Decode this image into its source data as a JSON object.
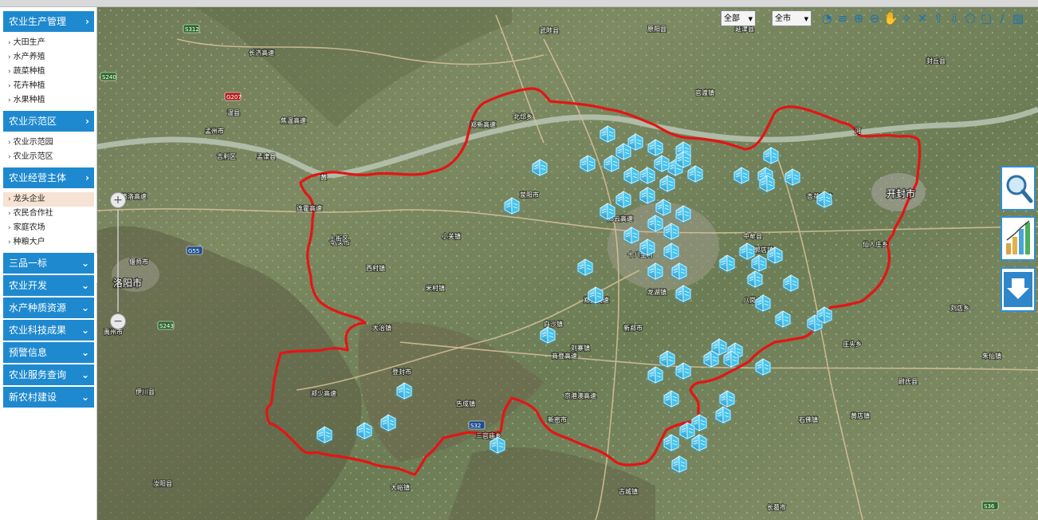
{
  "sidebar": {
    "sections": [
      {
        "title": "农业生产管理",
        "expanded": true,
        "items": [
          "大田生产",
          "水产养殖",
          "蔬菜种植",
          "花卉种植",
          "水果种植"
        ]
      },
      {
        "title": "农业示范区",
        "expanded": true,
        "items": [
          "农业示范园",
          "农业示范区"
        ]
      },
      {
        "title": "农业经营主体",
        "expanded": true,
        "items": [
          "龙头企业",
          "农民合作社",
          "家庭农场",
          "种粮大户"
        ],
        "active_item": "龙头企业"
      },
      {
        "title": "三品一标",
        "expanded": false,
        "items": []
      },
      {
        "title": "农业开发",
        "expanded": false,
        "items": []
      },
      {
        "title": "水产种质资源",
        "expanded": false,
        "items": []
      },
      {
        "title": "农业科技成果",
        "expanded": false,
        "items": []
      },
      {
        "title": "预警信息",
        "expanded": false,
        "items": []
      },
      {
        "title": "农业服务查询",
        "expanded": false,
        "items": []
      },
      {
        "title": "新农村建设",
        "expanded": false,
        "items": []
      }
    ]
  },
  "toolbar": {
    "select_type": "全部",
    "select_area": "全市",
    "tools": [
      "pie-chart-icon",
      "layers-icon",
      "zoom-in-icon",
      "zoom-out-icon",
      "pan-hand-icon",
      "full-extent-icon",
      "clear-icon",
      "upload-icon",
      "download-icon",
      "polygon-icon",
      "rectangle-icon",
      "measure-line-icon",
      "measure-area-icon"
    ]
  },
  "side_buttons": [
    "search-icon",
    "chart-bars-icon",
    "download-arrow-icon"
  ],
  "map": {
    "colors": {
      "boundary": "#e31515",
      "marker": "#3ec9f0",
      "river": "#b9c6b4",
      "label": "#ffffff"
    },
    "cities": [
      {
        "name": "洛阳市"
      },
      {
        "name": "开封市"
      },
      {
        "name": "登封市"
      },
      {
        "name": "新郑市"
      },
      {
        "name": "荥阳市"
      },
      {
        "name": "巩义市"
      },
      {
        "name": "偃师市"
      },
      {
        "name": "孟州市"
      },
      {
        "name": "温县"
      },
      {
        "name": "武陟县"
      },
      {
        "name": "原阳县"
      },
      {
        "name": "延津县"
      },
      {
        "name": "封丘县"
      },
      {
        "name": "长葛市"
      },
      {
        "name": "禹州市"
      },
      {
        "name": "尉氏县"
      },
      {
        "name": "伊川县"
      },
      {
        "name": "汝阳县"
      },
      {
        "name": "孟津县"
      },
      {
        "name": "吉利区"
      },
      {
        "name": "中牟县"
      },
      {
        "name": "新密市"
      }
    ],
    "towns": [
      {
        "name": "上街区"
      },
      {
        "name": "大峪镇"
      },
      {
        "name": "刘寨镇"
      },
      {
        "name": "米村镇"
      },
      {
        "name": "西村镇"
      },
      {
        "name": "小关镇"
      },
      {
        "name": "大冶镇"
      },
      {
        "name": "告成镇"
      },
      {
        "name": "郭店镇"
      },
      {
        "name": "八岗乡"
      },
      {
        "name": "古城镇"
      },
      {
        "name": "庄头乡"
      },
      {
        "name": "三官庙乡"
      },
      {
        "name": "杏花营镇"
      },
      {
        "name": "仙人庄乡"
      },
      {
        "name": "刘店乡"
      },
      {
        "name": "白沙镇"
      },
      {
        "name": "官渡镇"
      },
      {
        "name": "北邙乡"
      },
      {
        "name": "朱仙镇"
      },
      {
        "name": "石佛镇"
      },
      {
        "name": "黄店镇"
      },
      {
        "name": "龙湖镇"
      },
      {
        "name": "十八里河"
      }
    ],
    "roads": [
      {
        "name": "连霍高速"
      },
      {
        "name": "郑少高速"
      },
      {
        "name": "商登高速"
      },
      {
        "name": "郑民高速"
      },
      {
        "name": "京港澳高速"
      },
      {
        "name": "郑新高速"
      },
      {
        "name": "济洛高速"
      },
      {
        "name": "长济高速"
      },
      {
        "name": "焦温高速"
      },
      {
        "name": "郑云高速"
      }
    ],
    "shields": [
      {
        "name": "S312"
      },
      {
        "name": "S240"
      },
      {
        "name": "G207"
      },
      {
        "name": "G55"
      },
      {
        "name": "S243"
      },
      {
        "name": "S32"
      },
      {
        "name": "S36"
      }
    ],
    "rivers": [
      {
        "name": "黄"
      },
      {
        "name": "河"
      }
    ]
  }
}
